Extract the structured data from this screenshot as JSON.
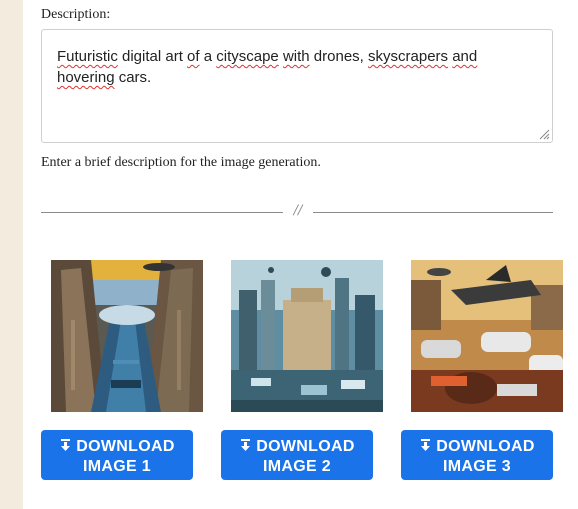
{
  "form": {
    "description_label": "Description:",
    "description_value_parts": [
      "Futuristic",
      " digital art ",
      "of",
      " a ",
      "cityscape",
      " ",
      "with",
      " drones, ",
      "skyscrapers",
      " ",
      "and",
      " ",
      "hovering",
      " cars."
    ],
    "hint": "Enter a brief description for the image generation."
  },
  "divider": {
    "mark": "//"
  },
  "images": [
    {
      "button_line1": "DOWNLOAD",
      "button_line2": "IMAGE 1",
      "icon": "download-icon"
    },
    {
      "button_line1": "DOWNLOAD",
      "button_line2": "IMAGE 2",
      "icon": "download-icon"
    },
    {
      "button_line1": "DOWNLOAD",
      "button_line2": "IMAGE 3",
      "icon": "download-icon"
    }
  ],
  "colors": {
    "button": "#1a73e8",
    "page_bg": "#f3ebdd",
    "panel_bg": "#ffffff"
  }
}
